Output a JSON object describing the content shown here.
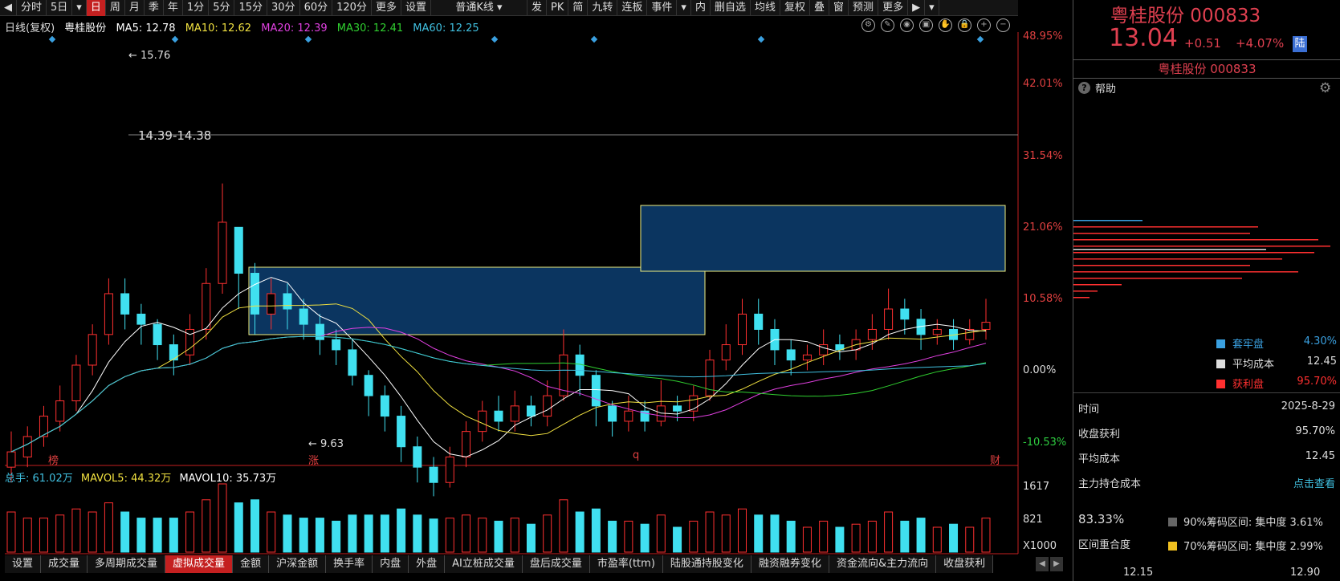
{
  "toolbar": {
    "items": [
      "分时",
      "5日",
      "日",
      "周",
      "月",
      "季",
      "年",
      "1分",
      "5分",
      "15分",
      "30分",
      "60分",
      "120分",
      "更多",
      "设置"
    ],
    "active": "日",
    "kline_type": "普通K线",
    "tools": [
      "发",
      "PK",
      "简",
      "九转",
      "连板",
      "事件",
      "内",
      "删自选",
      "均线",
      "复权",
      "叠",
      "窗",
      "预测",
      "更多"
    ]
  },
  "ma_header": {
    "period": "日线(复权)",
    "stock": "粤桂股份",
    "ma5": "MA5: 12.78",
    "ma10": "MA10: 12.62",
    "ma20": "MA20: 12.39",
    "ma30": "MA30: 12.41",
    "ma60": "MA60: 12.25"
  },
  "axis": {
    "pct_labels": [
      "48.95%",
      "42.01%",
      "31.54%",
      "21.06%",
      "10.58%",
      "0.00%",
      "-10.53%"
    ],
    "vol_labels": [
      "1617",
      "821",
      "X1000"
    ]
  },
  "annotations": {
    "high": "15.76",
    "low": "9.63",
    "range_line": "14.39-14.38",
    "bottom_marks": [
      "榜",
      "涨",
      "q",
      "财"
    ]
  },
  "vol_header": {
    "total": "总手: 61.02万",
    "mavol5": "MAVOL5: 44.32万",
    "mavol10": "MAVOL10: 35.73万"
  },
  "bottom_tabs": {
    "items": [
      "设置",
      "成交量",
      "多周期成交量",
      "虚拟成交量",
      "金额",
      "沪深金额",
      "换手率",
      "内盘",
      "外盘",
      "AI立桩成交量",
      "盘后成交量",
      "市盈率(ttm)",
      "陆股通持股变化",
      "融资融券变化",
      "资金流向&主力流向",
      "收盘获利"
    ],
    "active": "虚拟成交量"
  },
  "panel": {
    "title": "粤桂股份 000833",
    "price": "13.04",
    "change": "+0.51",
    "change_pct": "+4.07%",
    "badge": "陆",
    "subtitle": "粤桂股份 000833",
    "help": "帮助",
    "legend": [
      {
        "label": "套牢盘",
        "value": "4.30%",
        "color": "#3aa0e0"
      },
      {
        "label": "平均成本",
        "value": "12.45",
        "color": "#dddddd"
      },
      {
        "label": "获利盘",
        "value": "95.70%",
        "color": "#ff3030"
      }
    ],
    "info": [
      {
        "label": "时间",
        "value": "2025-8-29"
      },
      {
        "label": "收盘获利",
        "value": "95.70%"
      },
      {
        "label": "平均成本",
        "value": "12.45"
      },
      {
        "label": "主力持仓成本",
        "value": "点击查看"
      }
    ],
    "concentration_pct": "83.33%",
    "conc90": "90%筹码区间:  集中度  3.61%",
    "conc70": "70%筹码区间:  集中度  2.99%",
    "overlap": "区间重合度",
    "bottom_left": "12.15",
    "bottom_right": "12.90"
  },
  "chart_data": {
    "type": "candlestick",
    "title": "粤桂股份 000833 日线(复权)",
    "yaxis_pct": [
      48.95,
      42.01,
      31.54,
      21.06,
      10.58,
      0.0,
      -10.53
    ],
    "high_label": 15.76,
    "low_label": 9.63,
    "last_close": 13.04,
    "candles": [
      {
        "o": 10.2,
        "c": 10.5,
        "h": 10.9,
        "l": 9.9
      },
      {
        "o": 10.4,
        "c": 10.8,
        "h": 11.0,
        "l": 10.2
      },
      {
        "o": 10.8,
        "c": 11.2,
        "h": 11.4,
        "l": 10.6
      },
      {
        "o": 11.1,
        "c": 11.5,
        "h": 11.8,
        "l": 10.9
      },
      {
        "o": 11.5,
        "c": 12.2,
        "h": 12.4,
        "l": 11.3
      },
      {
        "o": 12.2,
        "c": 12.8,
        "h": 13.0,
        "l": 12.0
      },
      {
        "o": 12.8,
        "c": 13.6,
        "h": 13.9,
        "l": 12.6
      },
      {
        "o": 13.6,
        "c": 13.2,
        "h": 13.9,
        "l": 12.9
      },
      {
        "o": 13.2,
        "c": 13.0,
        "h": 13.4,
        "l": 12.6
      },
      {
        "o": 13.0,
        "c": 12.6,
        "h": 13.1,
        "l": 12.3
      },
      {
        "o": 12.6,
        "c": 12.3,
        "h": 12.8,
        "l": 12.0
      },
      {
        "o": 12.4,
        "c": 12.9,
        "h": 13.2,
        "l": 12.2
      },
      {
        "o": 12.9,
        "c": 13.8,
        "h": 14.1,
        "l": 12.7
      },
      {
        "o": 13.8,
        "c": 15.0,
        "h": 15.76,
        "l": 13.6
      },
      {
        "o": 14.9,
        "c": 14.0,
        "h": 14.6,
        "l": 13.3
      },
      {
        "o": 14.0,
        "c": 13.2,
        "h": 14.2,
        "l": 12.8
      },
      {
        "o": 13.2,
        "c": 13.6,
        "h": 13.9,
        "l": 12.9
      },
      {
        "o": 13.6,
        "c": 13.3,
        "h": 13.8,
        "l": 12.9
      },
      {
        "o": 13.3,
        "c": 13.0,
        "h": 13.5,
        "l": 12.7
      },
      {
        "o": 13.0,
        "c": 12.7,
        "h": 13.2,
        "l": 12.4
      },
      {
        "o": 12.7,
        "c": 12.5,
        "h": 12.9,
        "l": 12.2
      },
      {
        "o": 12.5,
        "c": 12.0,
        "h": 12.7,
        "l": 11.8
      },
      {
        "o": 12.0,
        "c": 11.6,
        "h": 12.1,
        "l": 11.2
      },
      {
        "o": 11.6,
        "c": 11.2,
        "h": 11.8,
        "l": 10.9
      },
      {
        "o": 11.2,
        "c": 10.6,
        "h": 11.4,
        "l": 10.3
      },
      {
        "o": 10.6,
        "c": 10.2,
        "h": 10.8,
        "l": 9.9
      },
      {
        "o": 10.2,
        "c": 9.9,
        "h": 10.4,
        "l": 9.63
      },
      {
        "o": 9.9,
        "c": 10.4,
        "h": 10.6,
        "l": 9.8
      },
      {
        "o": 10.4,
        "c": 10.9,
        "h": 11.1,
        "l": 10.2
      },
      {
        "o": 10.9,
        "c": 11.3,
        "h": 11.5,
        "l": 10.7
      },
      {
        "o": 11.3,
        "c": 11.1,
        "h": 11.6,
        "l": 10.9
      },
      {
        "o": 11.1,
        "c": 11.4,
        "h": 11.7,
        "l": 10.9
      },
      {
        "o": 11.4,
        "c": 11.2,
        "h": 11.6,
        "l": 11.0
      },
      {
        "o": 11.2,
        "c": 11.6,
        "h": 11.9,
        "l": 11.0
      },
      {
        "o": 11.6,
        "c": 12.4,
        "h": 12.9,
        "l": 11.5
      },
      {
        "o": 12.4,
        "c": 12.0,
        "h": 12.6,
        "l": 11.6
      },
      {
        "o": 12.0,
        "c": 11.4,
        "h": 12.1,
        "l": 11.0
      },
      {
        "o": 11.4,
        "c": 11.1,
        "h": 11.5,
        "l": 10.8
      },
      {
        "o": 11.1,
        "c": 11.3,
        "h": 11.6,
        "l": 10.9
      },
      {
        "o": 11.3,
        "c": 11.1,
        "h": 11.5,
        "l": 10.9
      },
      {
        "o": 11.1,
        "c": 11.4,
        "h": 11.9,
        "l": 11.0
      },
      {
        "o": 11.4,
        "c": 11.3,
        "h": 11.6,
        "l": 11.1
      },
      {
        "o": 11.3,
        "c": 11.6,
        "h": 11.8,
        "l": 11.1
      },
      {
        "o": 11.6,
        "c": 12.3,
        "h": 12.5,
        "l": 11.5
      },
      {
        "o": 12.3,
        "c": 12.6,
        "h": 13.0,
        "l": 12.1
      },
      {
        "o": 12.6,
        "c": 13.2,
        "h": 13.5,
        "l": 12.4
      },
      {
        "o": 13.2,
        "c": 12.9,
        "h": 13.5,
        "l": 12.6
      },
      {
        "o": 12.9,
        "c": 12.5,
        "h": 13.1,
        "l": 12.2
      },
      {
        "o": 12.5,
        "c": 12.3,
        "h": 12.7,
        "l": 12.0
      },
      {
        "o": 12.3,
        "c": 12.4,
        "h": 12.6,
        "l": 12.1
      },
      {
        "o": 12.4,
        "c": 12.6,
        "h": 12.9,
        "l": 12.2
      },
      {
        "o": 12.6,
        "c": 12.5,
        "h": 12.8,
        "l": 12.3
      },
      {
        "o": 12.5,
        "c": 12.7,
        "h": 12.9,
        "l": 12.3
      },
      {
        "o": 12.7,
        "c": 12.9,
        "h": 13.2,
        "l": 12.5
      },
      {
        "o": 12.9,
        "c": 13.3,
        "h": 13.7,
        "l": 12.7
      },
      {
        "o": 13.3,
        "c": 13.1,
        "h": 13.5,
        "l": 12.8
      },
      {
        "o": 13.1,
        "c": 12.8,
        "h": 13.3,
        "l": 12.5
      },
      {
        "o": 12.8,
        "c": 12.9,
        "h": 13.1,
        "l": 12.6
      },
      {
        "o": 12.9,
        "c": 12.7,
        "h": 13.1,
        "l": 12.5
      },
      {
        "o": 12.7,
        "c": 12.9,
        "h": 13.1,
        "l": 12.6
      },
      {
        "o": 12.9,
        "c": 13.04,
        "h": 13.5,
        "l": 12.7
      }
    ]
  }
}
